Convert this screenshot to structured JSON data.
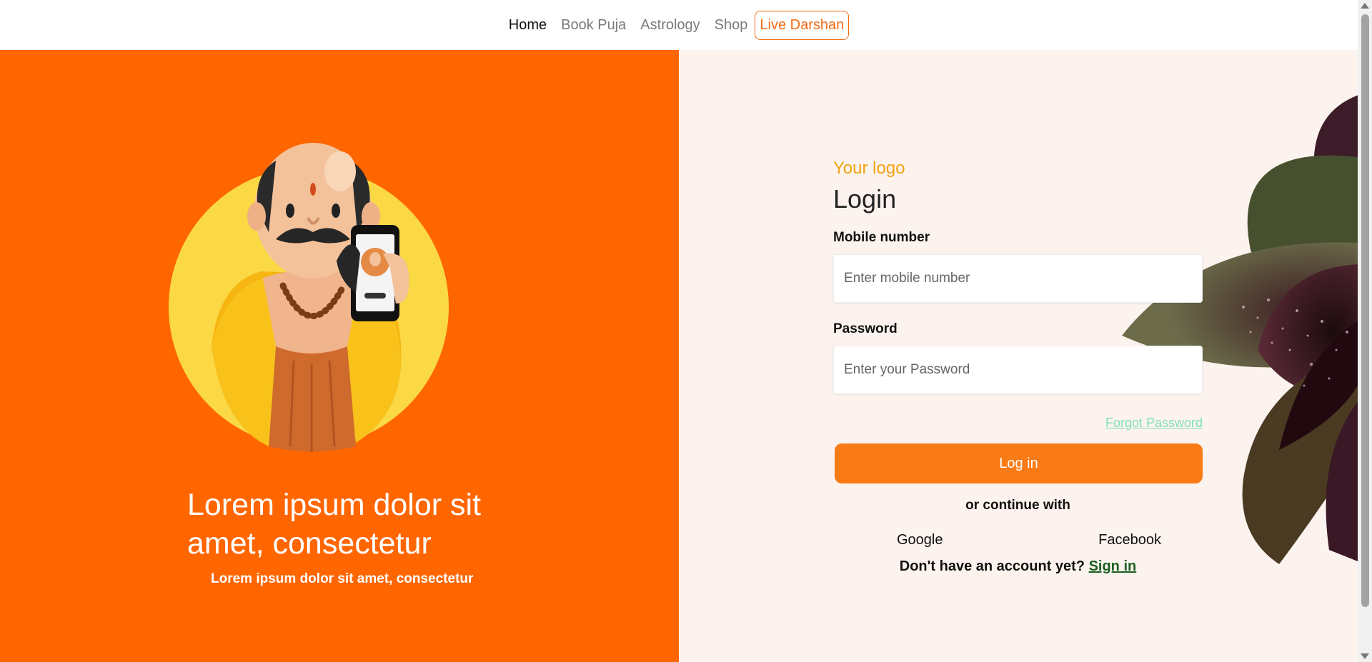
{
  "nav": {
    "items": [
      {
        "label": "Home"
      },
      {
        "label": "Book Puja"
      },
      {
        "label": "Astrology"
      },
      {
        "label": "Shop"
      }
    ],
    "live_label": "Live Darshan"
  },
  "hero": {
    "title": "Lorem ipsum dolor sit amet, consectetur",
    "subtitle": "Lorem ipsum dolor sit amet, consectetur"
  },
  "form": {
    "logo": "Your logo",
    "title": "Login",
    "mobile_label": "Mobile number",
    "mobile_placeholder": "Enter mobile number",
    "password_label": "Password",
    "password_placeholder": "Enter your Password",
    "forgot": "Forgot Password",
    "login_button": "Log in",
    "continue_text": "or continue with",
    "google": "Google",
    "facebook": "Facebook",
    "signup_prompt": "Don't have an account yet?",
    "signup_link": "Sign in"
  },
  "colors": {
    "hero_bg": "#ff6600",
    "panel_bg": "#fdf3ee",
    "accent": "#f97b16",
    "logo": "#f1a312",
    "forgot": "#7fe0bb"
  },
  "icons": [
    "priest-illustration",
    "flower-petals-decoration"
  ]
}
